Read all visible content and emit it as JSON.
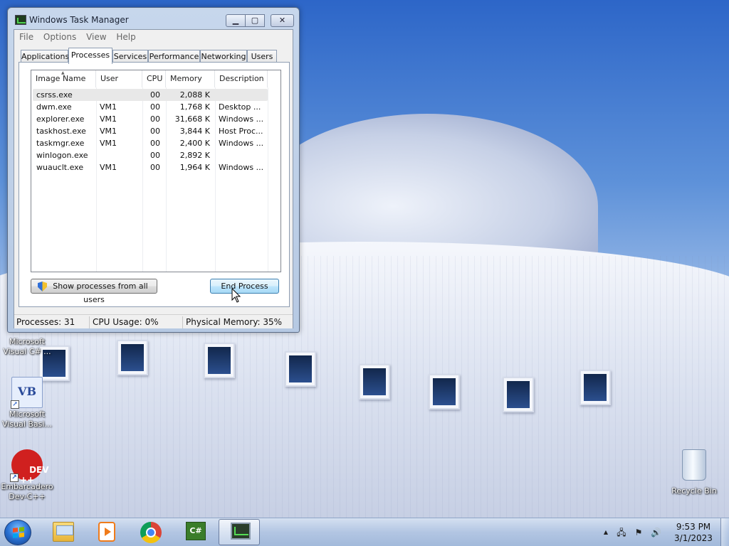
{
  "window": {
    "title": "Windows Task Manager",
    "min_glyph": "▁",
    "max_glyph": "▢",
    "close_glyph": "✕"
  },
  "menu": [
    "File",
    "Options",
    "View",
    "Help"
  ],
  "tabs": [
    "Applications",
    "Processes",
    "Services",
    "Performance",
    "Networking",
    "Users"
  ],
  "active_tab": "Processes",
  "columns": [
    "Image Name",
    "User Name",
    "CPU",
    "Memory (...",
    "Description"
  ],
  "processes": [
    {
      "image": "csrss.exe",
      "user": "",
      "cpu": "00",
      "memory": "2,088 K",
      "description": ""
    },
    {
      "image": "dwm.exe",
      "user": "VM1",
      "cpu": "00",
      "memory": "1,768 K",
      "description": "Desktop ..."
    },
    {
      "image": "explorer.exe",
      "user": "VM1",
      "cpu": "00",
      "memory": "31,668 K",
      "description": "Windows ..."
    },
    {
      "image": "taskhost.exe",
      "user": "VM1",
      "cpu": "00",
      "memory": "3,844 K",
      "description": "Host Proc..."
    },
    {
      "image": "taskmgr.exe",
      "user": "VM1",
      "cpu": "00",
      "memory": "2,400 K",
      "description": "Windows ..."
    },
    {
      "image": "winlogon.exe",
      "user": "",
      "cpu": "00",
      "memory": "2,892 K",
      "description": ""
    },
    {
      "image": "wuauclt.exe",
      "user": "VM1",
      "cpu": "00",
      "memory": "1,964 K",
      "description": "Windows ..."
    }
  ],
  "buttons": {
    "show_all": "Show processes from all users",
    "end_process": "End Process"
  },
  "status": {
    "processes": "Processes: 31",
    "cpu": "CPU Usage: 0%",
    "memory": "Physical Memory: 35%"
  },
  "desktop_icons": {
    "cs": {
      "line1": "Microsoft",
      "line2": "Visual C# ..."
    },
    "vb": {
      "glyph": "VB",
      "line1": "Microsoft",
      "line2": "Visual Basi..."
    },
    "dev": {
      "glyph": "DEV\n++",
      "line1": "Embarcadero",
      "line2": "Dev-C++"
    },
    "bin": {
      "line1": "Recycle Bin"
    }
  },
  "taskbar": {
    "cs_glyph": "C#",
    "clock_time": "9:53 PM",
    "clock_date": "3/1/2023",
    "tray_up": "▲",
    "tray_network": "🖧",
    "tray_flag": "⚑",
    "tray_volume": "🔊"
  }
}
